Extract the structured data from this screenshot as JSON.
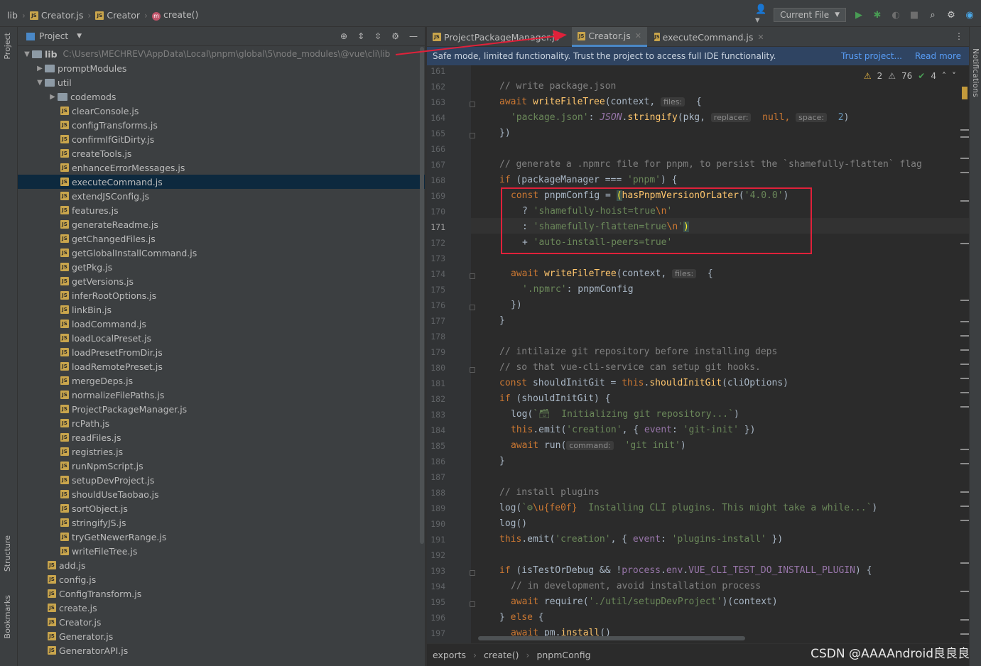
{
  "breadcrumb": {
    "lib": "lib",
    "file": "Creator.js",
    "class": "Creator",
    "method": "create()"
  },
  "toolbar": {
    "run_config": "Current File"
  },
  "left_strip": {
    "project": "Project",
    "structure": "Structure",
    "bookmarks": "Bookmarks"
  },
  "right_strip": {
    "notifications": "Notifications"
  },
  "project_panel": {
    "title": "Project",
    "root": {
      "name": "lib",
      "path": "C:\\Users\\MECHREV\\AppData\\Local\\pnpm\\global\\5\\node_modules\\@vue\\cli\\lib"
    },
    "folders": {
      "promptModules": "promptModules",
      "util": "util",
      "codemods": "codemods"
    },
    "util_files": [
      "clearConsole.js",
      "configTransforms.js",
      "confirmIfGitDirty.js",
      "createTools.js",
      "enhanceErrorMessages.js",
      "executeCommand.js",
      "extendJSConfig.js",
      "features.js",
      "generateReadme.js",
      "getChangedFiles.js",
      "getGlobalInstallCommand.js",
      "getPkg.js",
      "getVersions.js",
      "inferRootOptions.js",
      "linkBin.js",
      "loadCommand.js",
      "loadLocalPreset.js",
      "loadPresetFromDir.js",
      "loadRemotePreset.js",
      "mergeDeps.js",
      "normalizeFilePaths.js",
      "ProjectPackageManager.js",
      "rcPath.js",
      "readFiles.js",
      "registries.js",
      "runNpmScript.js",
      "setupDevProject.js",
      "shouldUseTaobao.js",
      "sortObject.js",
      "stringifyJS.js",
      "tryGetNewerRange.js",
      "writeFileTree.js"
    ],
    "lib_files": [
      "add.js",
      "config.js",
      "ConfigTransform.js",
      "create.js",
      "Creator.js",
      "Generator.js",
      "GeneratorAPI.js"
    ],
    "selected": "executeCommand.js"
  },
  "tabs": [
    {
      "label": "ProjectPackageManager.js"
    },
    {
      "label": "Creator.js"
    },
    {
      "label": "executeCommand.js"
    }
  ],
  "banner": {
    "text": "Safe mode, limited functionality. Trust the project to access full IDE functionality.",
    "trust_link": "Trust project...",
    "read_more": "Read more"
  },
  "inspections": {
    "warnings_a": "2",
    "warnings_b": "76",
    "ok": "4"
  },
  "line_numbers": [
    "161",
    "162",
    "163",
    "164",
    "165",
    "166",
    "167",
    "168",
    "169",
    "170",
    "171",
    "172",
    "173",
    "174",
    "175",
    "176",
    "177",
    "178",
    "179",
    "180",
    "181",
    "182",
    "183",
    "184",
    "185",
    "186",
    "187",
    "188",
    "189",
    "190",
    "191",
    "192",
    "193",
    "194",
    "195",
    "196",
    "197"
  ],
  "current_line": "171",
  "code": {
    "l162": "// write package.json",
    "l163a": "await ",
    "l163b": "writeFileTree",
    "l163c": "(context, ",
    "l163h": "files:",
    "l163d": " {",
    "l164a": "'package.json'",
    "l164b": ": ",
    "l164c": "JSON",
    "l164d": ".",
    "l164e": "stringify",
    "l164f": "(pkg, ",
    "l164h1": "replacer:",
    "l164g": " null, ",
    "l164h2": "space:",
    "l164i": " 2",
    "l164j": ")",
    "l165": "})",
    "l167": "// generate a .npmrc file for pnpm, to persist the `shamefully-flatten` flag",
    "l168a": "if ",
    "l168b": "(packageManager === ",
    "l168c": "'pnpm'",
    "l168d": ") {",
    "l169a": "const ",
    "l169b": "pnpmConfig = ",
    "l169c": "(",
    "l169d": "hasPnpmVersionOrLater",
    "l169e": "(",
    "l169f": "'4.0.0'",
    "l169g": ")",
    "l170a": "? ",
    "l170b": "'shamefully-hoist=true",
    "l170c": "\\n",
    "l170d": "'",
    "l171a": ": ",
    "l171b": "'shamefully-flatten=true",
    "l171c": "\\n",
    "l171d": "'",
    "l171e": ")",
    "l172a": "+ ",
    "l172b": "'auto-install-peers=true'",
    "l174a": "await ",
    "l174b": "writeFileTree",
    "l174c": "(context, ",
    "l174h": "files:",
    "l174d": " {",
    "l175a": "'.npmrc'",
    "l175b": ": pnpmConfig",
    "l176": "})",
    "l177": "}",
    "l179": "// intilaize git repository before installing deps",
    "l180": "// so that vue-cli-service can setup git hooks.",
    "l181a": "const ",
    "l181b": "shouldInitGit = ",
    "l181c": "this",
    "l181d": ".",
    "l181e": "shouldInitGit",
    "l181f": "(cliOptions)",
    "l182a": "if ",
    "l182b": "(shouldInitGit) {",
    "l183a": "log(",
    "l183b": "`🗃  Initializing git repository...`",
    "l183c": ")",
    "l184a": "this",
    "l184b": ".emit(",
    "l184c": "'creation'",
    "l184d": ", { ",
    "l184e": "event",
    "l184f": ": ",
    "l184g": "'git-init'",
    "l184i": " })",
    "l185a": "await ",
    "l185b": "run(",
    "l185h": "command:",
    "l185c": " ",
    "l185d": "'git init'",
    "l185e": ")",
    "l186": "}",
    "l188": "// install plugins",
    "l189a": "log(",
    "l189b": "`⚙",
    "l189c": "\\u{fe0f}",
    "l189d": "  Installing CLI plugins. This might take a while...`",
    "l189e": ")",
    "l190": "log()",
    "l191a": "this",
    "l191b": ".emit(",
    "l191c": "'creation'",
    "l191d": ", { ",
    "l191e": "event",
    "l191f": ": ",
    "l191g": "'plugins-install'",
    "l191i": " })",
    "l193a": "if ",
    "l193b": "(isTestOrDebug && !",
    "l193c": "process",
    "l193d": ".",
    "l193e": "env",
    "l193f": ".",
    "l193g": "VUE_CLI_TEST_DO_INSTALL_PLUGIN",
    "l193i": ") {",
    "l194": "// in development, avoid installation process",
    "l195a": "await ",
    "l195b": "require(",
    "l195c": "'./util/setupDevProject'",
    "l195d": ")(context)",
    "l196a": "} ",
    "l196b": "else",
    "l196c": " {",
    "l197a": "await ",
    "l197b": "pm.",
    "l197c": "install",
    "l197d": "()"
  },
  "status": {
    "crumbs": [
      "exports",
      "create()",
      "pnpmConfig"
    ]
  },
  "watermark": "CSDN @AAAAndroid良良良",
  "colors": {
    "accent": "#4a88c7",
    "annotation": "#e0213a",
    "selection": "#0d293e"
  }
}
